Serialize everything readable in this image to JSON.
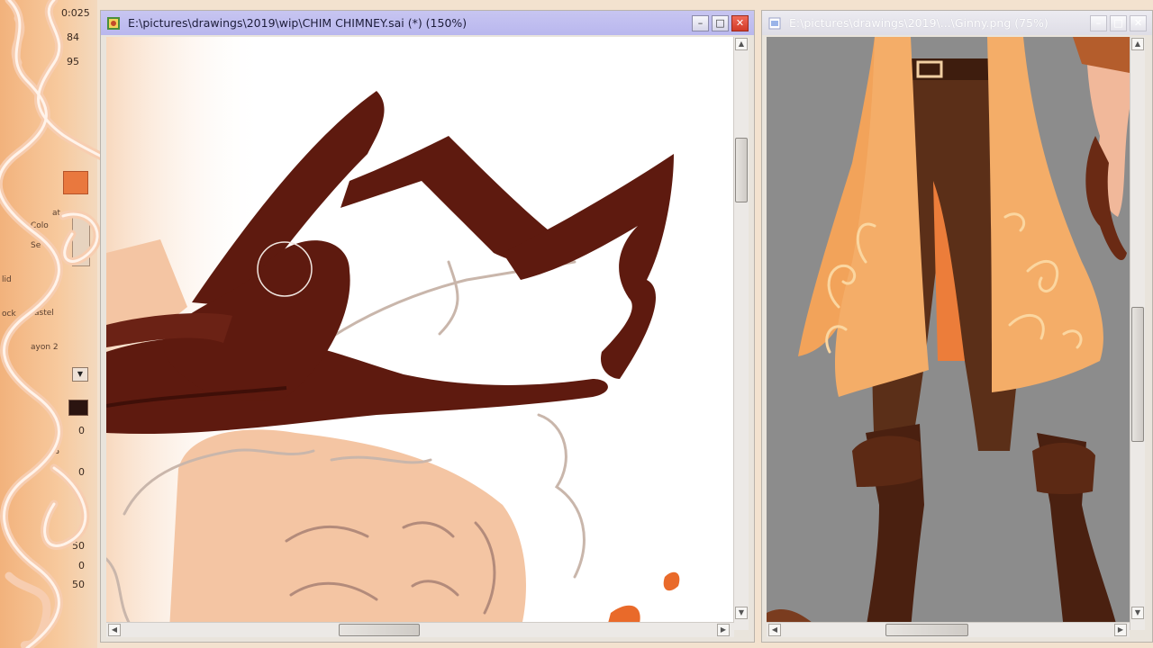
{
  "left_panel": {
    "readouts": [
      "0:025",
      "84",
      "95"
    ],
    "labels": [
      "at",
      "Colo",
      "Se",
      "lid",
      "ock",
      "astel",
      "ayon 2"
    ],
    "percent_symbol": "%",
    "values": [
      "0",
      "0",
      "50",
      "0",
      "50"
    ]
  },
  "windows": [
    {
      "id": "left",
      "title": "E:\\pictures\\drawings\\2019\\wip\\CHIM CHIMNEY.sai (*) (150%)",
      "active": true
    },
    {
      "id": "right",
      "title": "E:\\pictures\\drawings\\2019\\...\\Ginny.png (75%)",
      "active": false
    }
  ],
  "window_buttons": {
    "minimize": "–",
    "maximize": "□",
    "close": "✕"
  },
  "scroll_arrows": {
    "up": "▲",
    "down": "▼",
    "left": "◀",
    "right": "▶"
  },
  "icons": {
    "sai_doc": "paint-document-icon",
    "png_doc": "image-document-icon"
  },
  "colors": {
    "active_title": "#b9b7ee",
    "inactive_title": "#e3e2ea",
    "brush_brown": "#5e1a0f",
    "skin": "#f5c4a0",
    "coat_orange": "#f4a055",
    "canvas_gray": "#8c8c8c",
    "swirl_peach": "#f6c9a6"
  }
}
